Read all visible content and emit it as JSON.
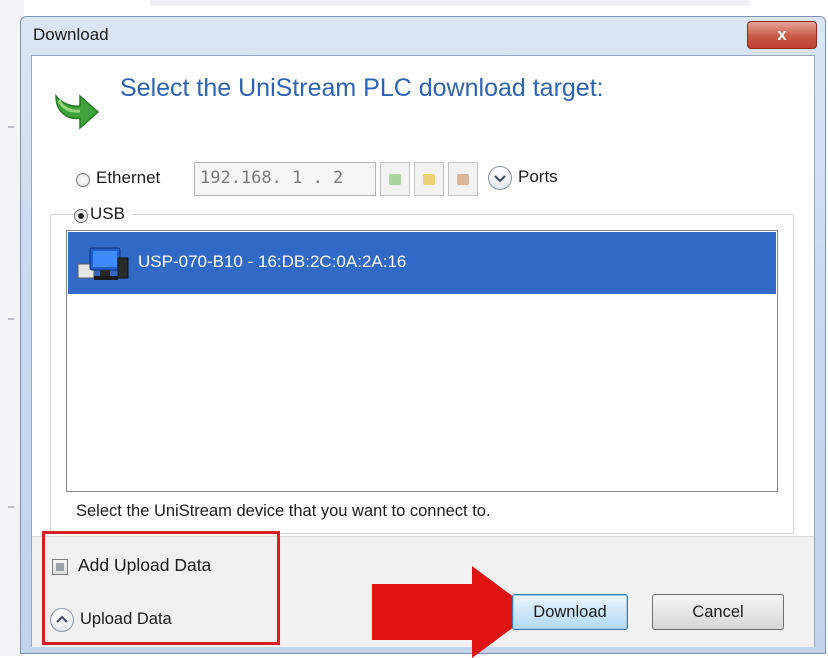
{
  "window": {
    "title": "Download",
    "close_label": "x"
  },
  "heading": "Select the UniStream PLC download target:",
  "ethernet": {
    "label": "Ethernet",
    "ip": "192.168. 1 . 2",
    "selected": false,
    "ports_label": "Ports"
  },
  "usb": {
    "label": "USB",
    "selected": true,
    "devices": [
      {
        "name": "USP-070-B10 - 16:DB:2C:0A:2A:16",
        "selected": true
      }
    ]
  },
  "hint": "Select the UniStream device that you want to connect to.",
  "options": {
    "add_upload_label": "Add Upload Data",
    "upload_label": "Upload Data"
  },
  "buttons": {
    "download": "Download",
    "cancel": "Cancel"
  },
  "colors": {
    "selection": "#3169c6",
    "heading": "#2d63b3",
    "highlight": "#d41f24"
  },
  "icons": [
    "download-arrow-icon",
    "refresh-icon",
    "folder-icon",
    "settings-icon",
    "chevron-down-icon",
    "computer-icon",
    "chevron-up-icon",
    "close-icon"
  ]
}
